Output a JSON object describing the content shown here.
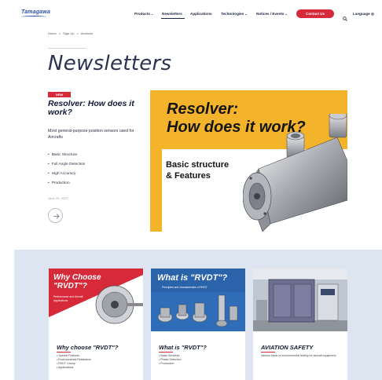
{
  "brand": {
    "logo_text": "Tamagawa",
    "accent": "#d6293a",
    "navy": "#1c2340"
  },
  "nav": {
    "items": [
      {
        "label": "Products",
        "has_dropdown": true
      },
      {
        "label": "Newsletters",
        "has_dropdown": false,
        "active": true
      },
      {
        "label": "Applications",
        "has_dropdown": false
      },
      {
        "label": "Technologies",
        "has_dropdown": true
      },
      {
        "label": "Notices / Events",
        "has_dropdown": true
      }
    ],
    "contact_label": "Contact Us",
    "search_icon": "search-icon",
    "language_label": "Language"
  },
  "breadcrumb": [
    "Home",
    ">",
    "Sign Up",
    ">",
    "Archives"
  ],
  "page_title": "Newsletters",
  "featured": {
    "badge": "NEW",
    "title": "Resolver: How does it work?",
    "description": "Most general-purpose position sensors used for Aircrafts",
    "bullets": [
      "Basic Structure",
      "Full Angle Detection",
      "High Accuracy",
      "Production"
    ],
    "date": "June 20, 2023",
    "arrow_icon": "arrow-right-icon",
    "hero_title_line1": "Resolver:",
    "hero_title_line2": "How does it work?",
    "hero_sub_line1": "Basic structure",
    "hero_sub_line2": "& Features",
    "hero_bg": "#f3b32b"
  },
  "cards": [
    {
      "image_title_line1": "Why Choose",
      "image_title_line2": "\"RVDT\"?",
      "image_sub": "Performance and Aircraft Applications",
      "title": "Why choose \"RVDT\"?",
      "bullets": [
        "Special Features",
        "Environmental Resistance",
        "RVDT Lineup",
        "Applications"
      ]
    },
    {
      "image_title": "What is \"RVDT\"?",
      "image_sub": "Principles and characteristics of RVDT",
      "title": "What is \"RVDT\"?",
      "bullets": [
        "Basic Structure",
        "Phase Detection",
        "Production"
      ]
    },
    {
      "title": "AVIATION SAFETY",
      "description": "Various kinds of environmental testing for aircraft equipment."
    }
  ]
}
